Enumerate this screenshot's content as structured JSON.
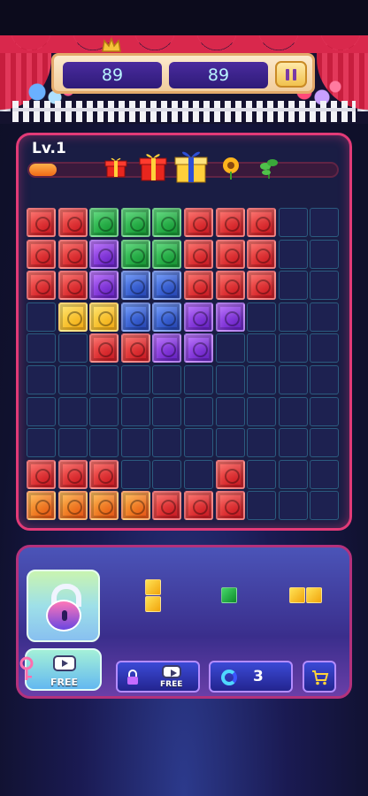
{
  "header": {
    "score_left": "89",
    "score_right": "89",
    "pause_icon": "pause-icon",
    "crown_icon": "crown-icon"
  },
  "level": {
    "label": "Lv.1",
    "progress": 0.09,
    "rewards": [
      "small-gift-icon",
      "red-gift-icon",
      "blue-gift-icon",
      "sunflower-icon",
      "green-plant-icon"
    ]
  },
  "board": {
    "size": 10,
    "blocks": [
      {
        "c": 0,
        "r": 0,
        "color": "red"
      },
      {
        "c": 1,
        "r": 0,
        "color": "red"
      },
      {
        "c": 2,
        "r": 0,
        "color": "green"
      },
      {
        "c": 3,
        "r": 0,
        "color": "green"
      },
      {
        "c": 4,
        "r": 0,
        "color": "green"
      },
      {
        "c": 5,
        "r": 0,
        "color": "red"
      },
      {
        "c": 6,
        "r": 0,
        "color": "red"
      },
      {
        "c": 7,
        "r": 0,
        "color": "red"
      },
      {
        "c": 0,
        "r": 1,
        "color": "red"
      },
      {
        "c": 1,
        "r": 1,
        "color": "red"
      },
      {
        "c": 2,
        "r": 1,
        "color": "purple"
      },
      {
        "c": 3,
        "r": 1,
        "color": "green"
      },
      {
        "c": 4,
        "r": 1,
        "color": "green"
      },
      {
        "c": 5,
        "r": 1,
        "color": "red"
      },
      {
        "c": 6,
        "r": 1,
        "color": "red"
      },
      {
        "c": 7,
        "r": 1,
        "color": "red"
      },
      {
        "c": 0,
        "r": 2,
        "color": "red"
      },
      {
        "c": 1,
        "r": 2,
        "color": "red"
      },
      {
        "c": 2,
        "r": 2,
        "color": "purple"
      },
      {
        "c": 3,
        "r": 2,
        "color": "blue"
      },
      {
        "c": 4,
        "r": 2,
        "color": "blue"
      },
      {
        "c": 5,
        "r": 2,
        "color": "red"
      },
      {
        "c": 6,
        "r": 2,
        "color": "red"
      },
      {
        "c": 7,
        "r": 2,
        "color": "red"
      },
      {
        "c": 1,
        "r": 3,
        "color": "yellow"
      },
      {
        "c": 2,
        "r": 3,
        "color": "yellow"
      },
      {
        "c": 3,
        "r": 3,
        "color": "blue"
      },
      {
        "c": 4,
        "r": 3,
        "color": "blue"
      },
      {
        "c": 5,
        "r": 3,
        "color": "purple"
      },
      {
        "c": 6,
        "r": 3,
        "color": "purple"
      },
      {
        "c": 2,
        "r": 4,
        "color": "red"
      },
      {
        "c": 3,
        "r": 4,
        "color": "red"
      },
      {
        "c": 4,
        "r": 4,
        "color": "purple"
      },
      {
        "c": 5,
        "r": 4,
        "color": "purple"
      },
      {
        "c": 0,
        "r": 8,
        "color": "red"
      },
      {
        "c": 1,
        "r": 8,
        "color": "red"
      },
      {
        "c": 2,
        "r": 8,
        "color": "red"
      },
      {
        "c": 6,
        "r": 8,
        "color": "red"
      },
      {
        "c": 0,
        "r": 9,
        "color": "orange"
      },
      {
        "c": 1,
        "r": 9,
        "color": "orange"
      },
      {
        "c": 2,
        "r": 9,
        "color": "orange"
      },
      {
        "c": 3,
        "r": 9,
        "color": "orange"
      },
      {
        "c": 4,
        "r": 9,
        "color": "red"
      },
      {
        "c": 5,
        "r": 9,
        "color": "red"
      },
      {
        "c": 6,
        "r": 9,
        "color": "red"
      }
    ]
  },
  "tray": {
    "pieces": [
      {
        "name": "piece-yellow-vertical-2",
        "color": "yellow",
        "cells": [
          [
            0,
            0
          ],
          [
            0,
            1
          ]
        ]
      },
      {
        "name": "piece-green-single",
        "color": "green",
        "cells": [
          [
            0,
            0
          ]
        ]
      },
      {
        "name": "piece-yellow-horizontal-2",
        "color": "yellow",
        "cells": [
          [
            0,
            0
          ],
          [
            1,
            0
          ]
        ]
      }
    ]
  },
  "buttons": {
    "free_video_label": "FREE",
    "free_lock_label": "FREE",
    "refresh_count": "3"
  },
  "colors": {
    "board_border": "#e23a77",
    "accent_purple": "#4a2b9e",
    "progress_orange": "#f06b17"
  }
}
